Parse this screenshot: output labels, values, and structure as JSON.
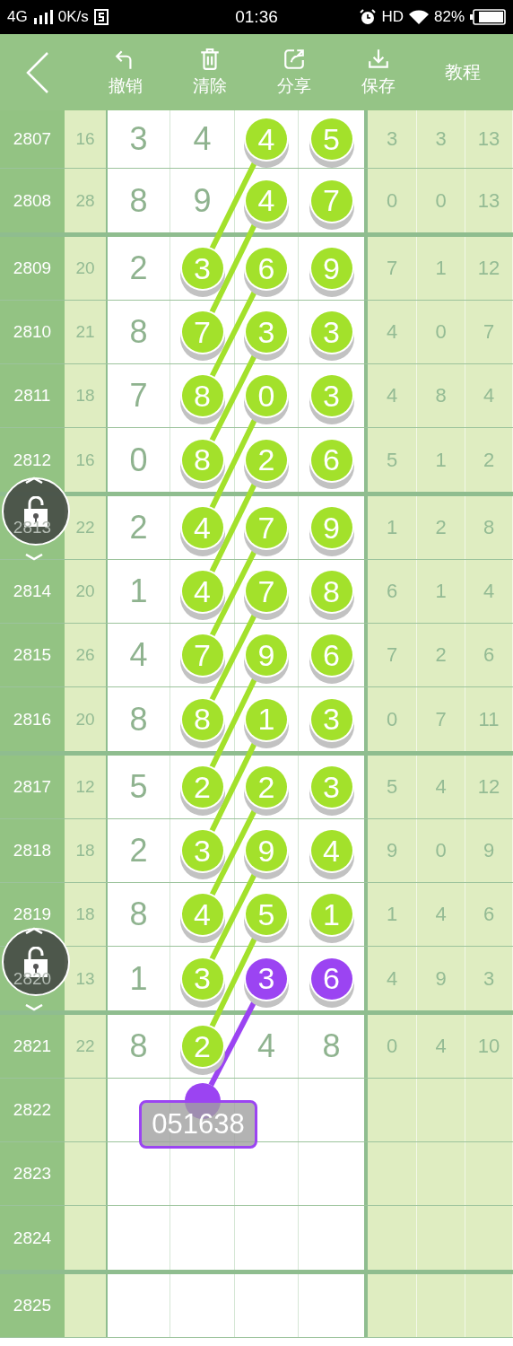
{
  "status_bar": {
    "network": "4G",
    "speed": "0K/s",
    "time": "01:36",
    "hd": "HD",
    "battery": "82%"
  },
  "toolbar": {
    "buttons": [
      {
        "label": "撤销"
      },
      {
        "label": "清除"
      },
      {
        "label": "分享"
      },
      {
        "label": "保存"
      }
    ],
    "tutorial": "教程"
  },
  "rows": [
    {
      "issue": "2807",
      "sum": "16",
      "digits": [
        {
          "value": "3",
          "kind": "plain"
        },
        {
          "value": "4",
          "kind": "plain"
        },
        {
          "value": "4",
          "kind": "green"
        },
        {
          "value": "5",
          "kind": "green"
        }
      ],
      "stats": [
        "3",
        "3",
        "13"
      ]
    },
    {
      "issue": "2808",
      "sum": "28",
      "digits": [
        {
          "value": "8",
          "kind": "plain"
        },
        {
          "value": "9",
          "kind": "plain"
        },
        {
          "value": "4",
          "kind": "green"
        },
        {
          "value": "7",
          "kind": "green"
        }
      ],
      "stats": [
        "0",
        "0",
        "13"
      ]
    },
    {
      "issue": "2809",
      "sum": "20",
      "digits": [
        {
          "value": "2",
          "kind": "plain"
        },
        {
          "value": "3",
          "kind": "green"
        },
        {
          "value": "6",
          "kind": "green"
        },
        {
          "value": "9",
          "kind": "green"
        }
      ],
      "stats": [
        "7",
        "1",
        "12"
      ]
    },
    {
      "issue": "2810",
      "sum": "21",
      "digits": [
        {
          "value": "8",
          "kind": "plain"
        },
        {
          "value": "7",
          "kind": "green"
        },
        {
          "value": "3",
          "kind": "green"
        },
        {
          "value": "3",
          "kind": "green"
        }
      ],
      "stats": [
        "4",
        "0",
        "7"
      ]
    },
    {
      "issue": "2811",
      "sum": "18",
      "digits": [
        {
          "value": "7",
          "kind": "plain"
        },
        {
          "value": "8",
          "kind": "green"
        },
        {
          "value": "0",
          "kind": "green"
        },
        {
          "value": "3",
          "kind": "green"
        }
      ],
      "stats": [
        "4",
        "8",
        "4"
      ]
    },
    {
      "issue": "2812",
      "sum": "16",
      "digits": [
        {
          "value": "0",
          "kind": "plain"
        },
        {
          "value": "8",
          "kind": "green"
        },
        {
          "value": "2",
          "kind": "green"
        },
        {
          "value": "6",
          "kind": "green"
        }
      ],
      "stats": [
        "5",
        "1",
        "2"
      ]
    },
    {
      "issue": "2813",
      "sum": "22",
      "lock": {
        "locked": false
      },
      "digits": [
        {
          "value": "2",
          "kind": "plain"
        },
        {
          "value": "4",
          "kind": "green"
        },
        {
          "value": "7",
          "kind": "green"
        },
        {
          "value": "9",
          "kind": "green"
        }
      ],
      "stats": [
        "1",
        "2",
        "8"
      ]
    },
    {
      "issue": "2814",
      "sum": "20",
      "digits": [
        {
          "value": "1",
          "kind": "plain"
        },
        {
          "value": "4",
          "kind": "green"
        },
        {
          "value": "7",
          "kind": "green"
        },
        {
          "value": "8",
          "kind": "green"
        }
      ],
      "stats": [
        "6",
        "1",
        "4"
      ]
    },
    {
      "issue": "2815",
      "sum": "26",
      "digits": [
        {
          "value": "4",
          "kind": "plain"
        },
        {
          "value": "7",
          "kind": "green"
        },
        {
          "value": "9",
          "kind": "green"
        },
        {
          "value": "6",
          "kind": "green"
        }
      ],
      "stats": [
        "7",
        "2",
        "6"
      ]
    },
    {
      "issue": "2816",
      "sum": "20",
      "digits": [
        {
          "value": "8",
          "kind": "plain"
        },
        {
          "value": "8",
          "kind": "green"
        },
        {
          "value": "1",
          "kind": "green"
        },
        {
          "value": "3",
          "kind": "green"
        }
      ],
      "stats": [
        "0",
        "7",
        "11"
      ]
    },
    {
      "issue": "2817",
      "sum": "12",
      "digits": [
        {
          "value": "5",
          "kind": "plain"
        },
        {
          "value": "2",
          "kind": "green"
        },
        {
          "value": "2",
          "kind": "green"
        },
        {
          "value": "3",
          "kind": "green"
        }
      ],
      "stats": [
        "5",
        "4",
        "12"
      ]
    },
    {
      "issue": "2818",
      "sum": "18",
      "digits": [
        {
          "value": "2",
          "kind": "plain"
        },
        {
          "value": "3",
          "kind": "green"
        },
        {
          "value": "9",
          "kind": "green"
        },
        {
          "value": "4",
          "kind": "green"
        }
      ],
      "stats": [
        "9",
        "0",
        "9"
      ]
    },
    {
      "issue": "2819",
      "sum": "18",
      "digits": [
        {
          "value": "8",
          "kind": "plain"
        },
        {
          "value": "4",
          "kind": "green"
        },
        {
          "value": "5",
          "kind": "green"
        },
        {
          "value": "1",
          "kind": "green"
        }
      ],
      "stats": [
        "1",
        "4",
        "6"
      ]
    },
    {
      "issue": "2820",
      "sum": "13",
      "lock": {
        "locked": false
      },
      "digits": [
        {
          "value": "1",
          "kind": "plain"
        },
        {
          "value": "3",
          "kind": "green"
        },
        {
          "value": "3",
          "kind": "purple"
        },
        {
          "value": "6",
          "kind": "purple"
        }
      ],
      "stats": [
        "4",
        "9",
        "3"
      ]
    },
    {
      "issue": "2821",
      "sum": "22",
      "digits": [
        {
          "value": "8",
          "kind": "plain"
        },
        {
          "value": "2",
          "kind": "green"
        },
        {
          "value": "4",
          "kind": "plain"
        },
        {
          "value": "8",
          "kind": "plain"
        }
      ],
      "stats": [
        "0",
        "4",
        "10"
      ]
    },
    {
      "issue": "2822",
      "tag": "051638"
    },
    {
      "issue": "2823"
    },
    {
      "issue": "2824"
    },
    {
      "issue": "2825"
    }
  ]
}
